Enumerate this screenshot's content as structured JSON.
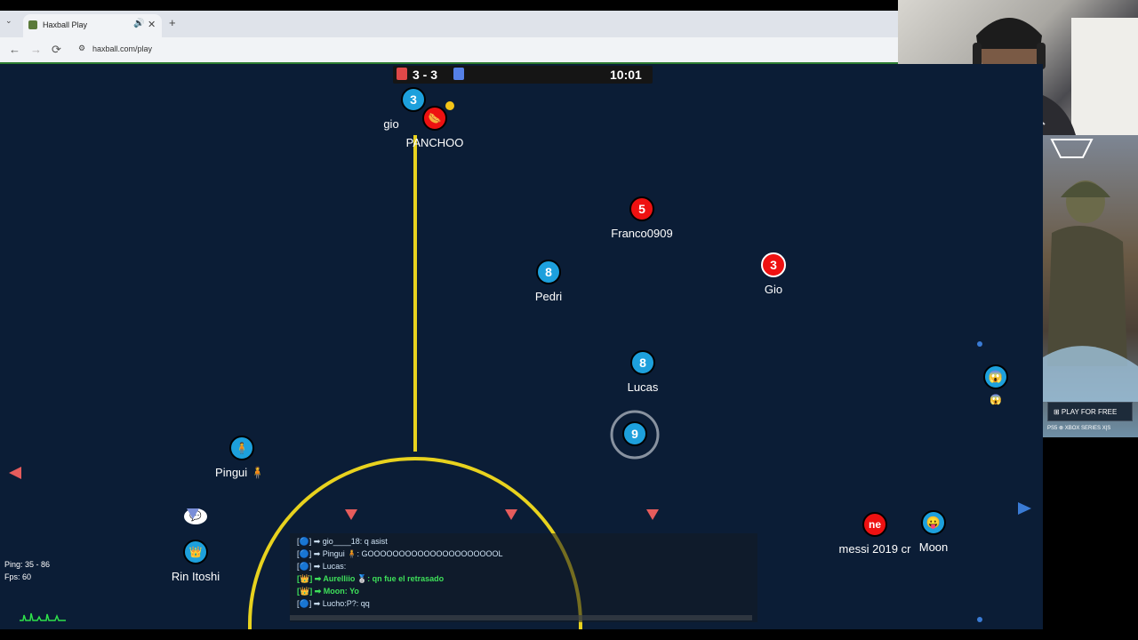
{
  "browser": {
    "tab_title": "Haxball Play",
    "url": "haxball.com/play",
    "new_tab": "+",
    "tab_close": "✕",
    "nav_back": "←",
    "nav_forward": "→",
    "nav_reload": "⟳"
  },
  "scoreboard": {
    "score": "3 - 3",
    "time": "10:01",
    "red_color": "#e04848",
    "blue_color": "#5580e6"
  },
  "players": [
    {
      "name": "gio",
      "number": "3",
      "team": "blue"
    },
    {
      "name": "PANCHOO",
      "number": "",
      "team": "red"
    },
    {
      "name": "Franco0909",
      "number": "5",
      "team": "red"
    },
    {
      "name": "Gio",
      "number": "3",
      "team": "red"
    },
    {
      "name": "Pedri",
      "number": "8",
      "team": "blue"
    },
    {
      "name": "Lucas",
      "number": "8",
      "team": "blue"
    },
    {
      "name": "",
      "number": "9",
      "team": "blue"
    },
    {
      "name": "Pingui 🧍",
      "number": "🧍",
      "team": "blue"
    },
    {
      "name": "Rin Itoshi",
      "number": "👑",
      "team": "blue"
    },
    {
      "name": "messi 2019 cr",
      "number": "ne",
      "team": "red"
    },
    {
      "name": "Moon",
      "number": "😛",
      "team": "blue"
    },
    {
      "name": "",
      "number": "😱",
      "team": "blue"
    }
  ],
  "extra": {
    "chat_bubble": "💬",
    "emoji_under": "😱"
  },
  "chat": [
    {
      "text": "[🔵] ➡ gio____18: q asist",
      "color": "#cfe3f5"
    },
    {
      "text": "[🔵] ➡ Pingui 🧍: GOOOOOOOOOOOOOOOOOOOOOL",
      "color": "#cfe3f5"
    },
    {
      "text": "[🔵] ➡ Lucas:",
      "color": "#cfe3f5"
    },
    {
      "text": "[👑] ➡ Aurelliio 🥈: qn fue el retrasado",
      "color": "#3ee05a"
    },
    {
      "text": "[👑] ➡ Moon: Yo",
      "color": "#3ee05a"
    },
    {
      "text": "[🔵] ➡ Lucho:P?: qq",
      "color": "#cfe3f5"
    }
  ],
  "stats": {
    "ping": "Ping: 35 - 86",
    "fps": "Fps: 60"
  },
  "ad": {
    "button": "⊞  PLAY FOR FREE",
    "platforms": "PS5  ⊗ XBOX SERIES X|S"
  }
}
